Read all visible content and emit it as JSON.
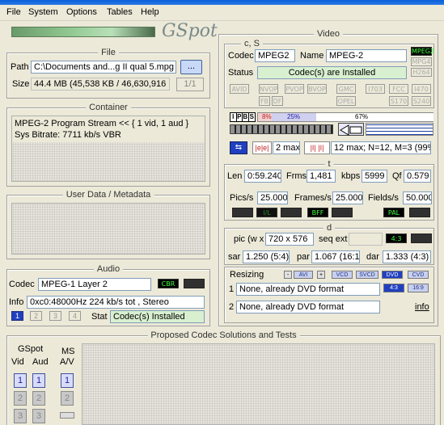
{
  "menu": [
    "File",
    "System",
    "Options",
    "Tables",
    "Help"
  ],
  "logo": "GSpot",
  "file": {
    "title": "File",
    "path_label": "Path",
    "path_value": "C:\\Documents and...g II qual 5.mpg",
    "browse_label": "...",
    "size_label": "Size",
    "size_value": "44.4 MB (45,538 KB / 46,630,916 b",
    "counter": "1/1"
  },
  "container": {
    "title": "Container",
    "line1": "MPEG-2 Program Stream << { 1 vid, 1 aud }",
    "line2": "Sys Bitrate: 7711 kb/s VBR"
  },
  "userdata": {
    "title": "User Data / Metadata"
  },
  "audio": {
    "title": "Audio",
    "codec_label": "Codec",
    "codec_value": "MPEG-1 Layer 2",
    "tag_cbr": "CBR",
    "info_label": "Info",
    "info_value": "0xc0:48000Hz  224 kb/s tot , Stereo",
    "streams": [
      "1",
      "2",
      "3",
      "4"
    ],
    "stat_label": "Stat",
    "stat_value": "Codec(s) Installed"
  },
  "proposed": {
    "title": "Proposed Codec Solutions and Tests",
    "gspot_label": "GSpot",
    "vid_label": "Vid",
    "aud_label": "Aud",
    "ms_label": "MS",
    "av_label": "A/V",
    "vid_buttons": [
      "1",
      "2",
      "3"
    ],
    "aud_buttons": [
      "1",
      "2",
      "3"
    ],
    "ms_buttons": [
      "1",
      "2"
    ]
  },
  "video": {
    "title": "Video",
    "cs_label": "c, S",
    "codec_label": "Codec",
    "codec_value": "MPEG2",
    "name_label": "Name",
    "name_value": "MPEG-2",
    "codec_tags": [
      "MPEG2",
      "MPG4",
      "H264"
    ],
    "status_label": "Status",
    "status_value": "Codec(s) are Installed",
    "feature_tags": [
      "AVID",
      "NVOP",
      "PVOP",
      "BVOP",
      "GMC",
      "I703",
      "FCC",
      "I470",
      "FB",
      "DF",
      "OPEL",
      "S170",
      "S240"
    ],
    "frame_letters": [
      "I",
      "P",
      "B",
      "S"
    ],
    "pct_i": "8%",
    "pct_p": "25%",
    "pct_b": "67%",
    "gop_value1": "2 max",
    "gop_value2": "12 max; N=12, M=3 (99%",
    "t_label": "t",
    "len_label": "Len",
    "len_value": "0:59.240",
    "frms_label": "Frms",
    "frms_value": "1,481",
    "kbps_label": "kbps",
    "kbps_value": "5999",
    "qf_label": "Qf",
    "qf_value": "0.579",
    "pics_label": "Pics/s",
    "pics_value": "25.000",
    "frames_label": "Frames/s",
    "frames_value": "25.000",
    "fields_label": "Fields/s",
    "fields_value": "50.000",
    "rate_tags": [
      "",
      "I/L",
      "",
      "BFF",
      "",
      "PAL",
      ""
    ],
    "d_label": "d",
    "pic_label": "pic (w x",
    "pic_value": "720 x 576",
    "seqext_label": "seq ext",
    "ratio_tag": "4:3",
    "sar_label": "sar",
    "sar_value": "1.250 (5:4)",
    "par_label": "par",
    "par_value": "1.067 (16:15",
    "dar_label": "dar",
    "dar_value": "1.333 (4:3)",
    "resizing_label": "Resizing",
    "resize_tags": [
      "AVI",
      "VCD",
      "SVCD",
      "DVD",
      "CVD"
    ],
    "resize_line1_num": "1",
    "resize_line1": "None, already DVD format",
    "ar_tags": [
      "4:3",
      "16:9"
    ],
    "resize_line2_num": "2",
    "resize_line2": "None, already DVD format",
    "info_link": "info"
  }
}
